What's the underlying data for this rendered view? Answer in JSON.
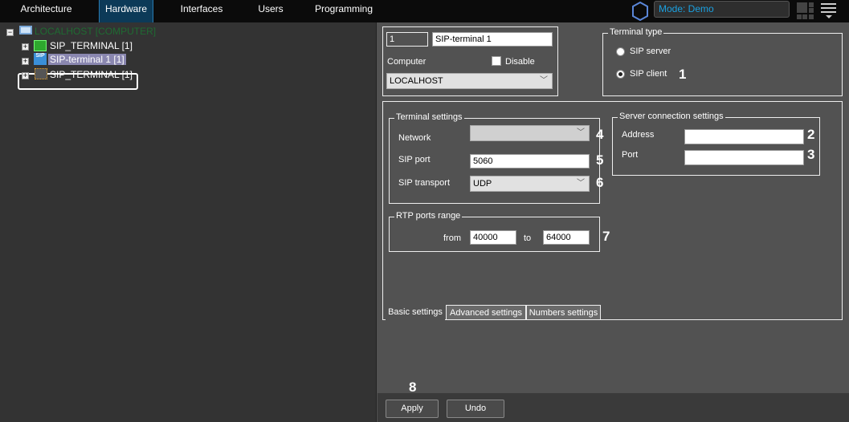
{
  "nav": {
    "tabs": [
      "Architecture",
      "Hardware",
      "Interfaces",
      "Users",
      "Programming"
    ],
    "active": "Hardware",
    "mode": "Mode: Demo"
  },
  "tree": {
    "root": "LOCALHOST [COMPUTER]",
    "items": [
      "SIP_TERMINAL [1]",
      "SIP-terminal 1 [1]",
      "SIP_TERMINAL [1]"
    ],
    "sip_icon_text": "SIP"
  },
  "general": {
    "id": "1",
    "name": "SIP-terminal 1",
    "computer_label": "Computer",
    "disable_label": "Disable",
    "computer_value": "LOCALHOST"
  },
  "terminal_type": {
    "title": "Terminal type",
    "options": [
      "SIP server",
      "SIP client"
    ],
    "selected": "SIP client"
  },
  "terminal_settings": {
    "title": "Terminal settings",
    "network_label": "Network",
    "network_value": "",
    "sip_port_label": "SIP port",
    "sip_port": "5060",
    "sip_transport_label": "SIP transport",
    "sip_transport": "UDP"
  },
  "server_connection": {
    "title": "Server connection settings",
    "address_label": "Address",
    "address": "",
    "port_label": "Port",
    "port": ""
  },
  "rtp": {
    "title": "RTP ports range",
    "from_label": "from",
    "from": "40000",
    "to_label": "to",
    "to": "64000"
  },
  "tabs": [
    "Basic settings",
    "Advanced settings",
    "Numbers settings"
  ],
  "buttons": {
    "apply": "Apply",
    "undo": "Undo"
  },
  "markers": [
    "1",
    "2",
    "3",
    "4",
    "5",
    "6",
    "7",
    "8"
  ]
}
